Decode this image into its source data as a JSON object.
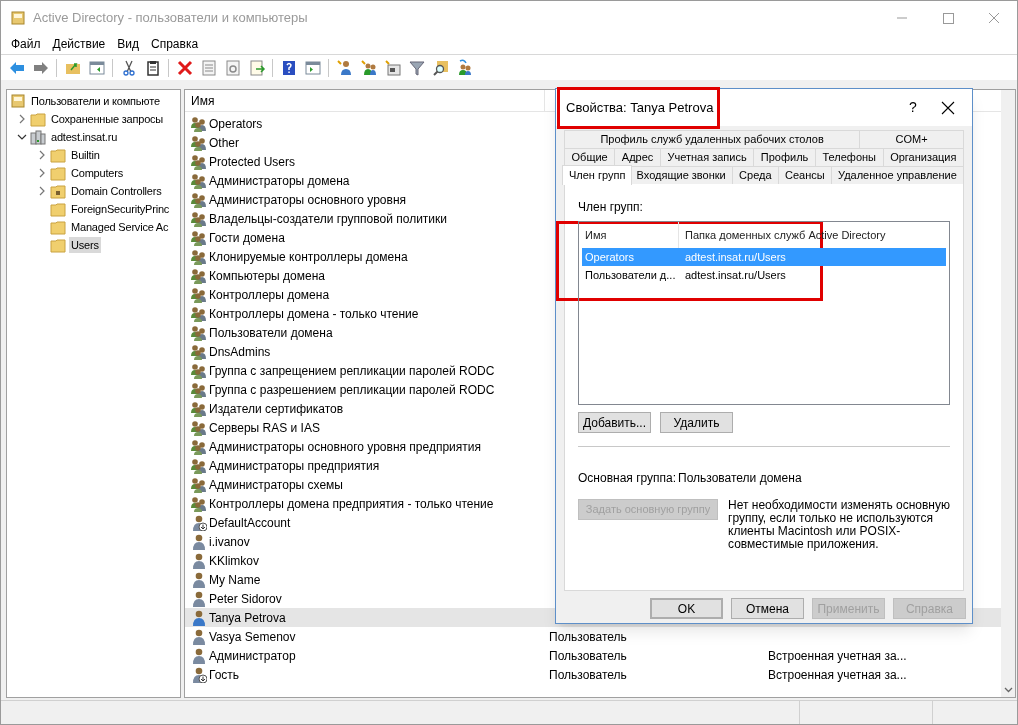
{
  "window": {
    "title": "Active Directory - пользователи и компьютеры"
  },
  "menu": [
    "Файл",
    "Действие",
    "Вид",
    "Справка"
  ],
  "tree": {
    "label": "Пользователи и компьюте",
    "kind": "root",
    "children": [
      {
        "label": "Сохраненные запросы",
        "kind": "folder",
        "expanded": false,
        "selected": false
      },
      {
        "label": "adtest.insat.ru",
        "kind": "domain",
        "expanded": true,
        "selected": false,
        "children": [
          {
            "label": "Builtin",
            "kind": "folder",
            "expanded": false,
            "selected": false
          },
          {
            "label": "Computers",
            "kind": "folder",
            "expanded": false,
            "selected": false
          },
          {
            "label": "Domain Controllers",
            "kind": "ou",
            "expanded": false,
            "selected": false
          },
          {
            "label": "ForeignSecurityPrinc",
            "kind": "folder",
            "selected": false
          },
          {
            "label": "Managed Service Ac",
            "kind": "folder",
            "selected": false
          },
          {
            "label": "Users",
            "kind": "folder",
            "selected": true
          }
        ]
      }
    ]
  },
  "list": {
    "columns": [
      "Имя"
    ],
    "rows": [
      {
        "name": "Operators",
        "kind": "group",
        "selected": false
      },
      {
        "name": "Other",
        "kind": "group",
        "selected": false
      },
      {
        "name": "Protected Users",
        "kind": "group",
        "selected": false
      },
      {
        "name": "Администраторы домена",
        "kind": "group",
        "selected": false
      },
      {
        "name": "Администраторы основного уровня",
        "kind": "group",
        "selected": false
      },
      {
        "name": "Владельцы-создатели групповой политики",
        "kind": "group",
        "selected": false
      },
      {
        "name": "Гости домена",
        "kind": "group",
        "selected": false
      },
      {
        "name": "Клонируемые контроллеры домена",
        "kind": "group",
        "selected": false
      },
      {
        "name": "Компьютеры домена",
        "kind": "group",
        "selected": false
      },
      {
        "name": "Контроллеры домена",
        "kind": "group",
        "selected": false
      },
      {
        "name": "Контроллеры домена - только чтение",
        "kind": "group",
        "selected": false
      },
      {
        "name": "Пользователи домена",
        "kind": "group",
        "selected": false
      },
      {
        "name": "DnsAdmins",
        "kind": "group",
        "selected": false
      },
      {
        "name": "Группа с запрещением репликации паролей RODC",
        "kind": "group",
        "selected": false
      },
      {
        "name": "Группа с разрешением репликации паролей RODC",
        "kind": "group",
        "selected": false
      },
      {
        "name": "Издатели сертификатов",
        "kind": "group",
        "selected": false
      },
      {
        "name": "Серверы RAS и IAS",
        "kind": "group",
        "selected": false
      },
      {
        "name": "Администраторы основного уровня предприятия",
        "kind": "group",
        "selected": false
      },
      {
        "name": "Администраторы предприятия",
        "kind": "group",
        "selected": false
      },
      {
        "name": "Администраторы схемы",
        "kind": "group",
        "selected": false
      },
      {
        "name": "Контроллеры домена предприятия - только чтение",
        "kind": "group",
        "selected": false
      },
      {
        "name": "DefaultAccount",
        "kind": "disabled-user",
        "selected": false
      },
      {
        "name": "i.ivanov",
        "kind": "user",
        "selected": false
      },
      {
        "name": "KKlimkov",
        "kind": "user",
        "selected": false
      },
      {
        "name": "My Name",
        "kind": "user",
        "selected": false
      },
      {
        "name": "Peter Sidorov",
        "kind": "user",
        "selected": false
      },
      {
        "name": "Tanya Petrova",
        "kind": "user",
        "selected": true
      },
      {
        "name": "Vasya Semenov",
        "kind": "user",
        "selected": false,
        "column_2": "Пользователь"
      },
      {
        "name": "Администратор",
        "kind": "user",
        "selected": false,
        "column_2": "Пользователь",
        "column_3": "Встроенная учетная за..."
      },
      {
        "name": "Гость",
        "kind": "disabled-user",
        "selected": false,
        "column_2": "Пользователь",
        "column_3": "Встроенная учетная за..."
      }
    ]
  },
  "dialog": {
    "title": "Свойства: Tanya Petrova",
    "title_highlighted": true,
    "help": "?",
    "tab_rows": [
      [
        {
          "label": "Профиль служб удаленных рабочих столов",
          "selected": false
        },
        {
          "label": "COM+",
          "selected": false
        }
      ],
      [
        {
          "label": "Общие",
          "selected": false
        },
        {
          "label": "Адрес",
          "selected": false
        },
        {
          "label": "Учетная запись",
          "selected": false
        },
        {
          "label": "Профиль",
          "selected": false
        },
        {
          "label": "Телефоны",
          "selected": false
        },
        {
          "label": "Организация",
          "selected": false
        }
      ],
      [
        {
          "label": "Член групп",
          "selected": true
        },
        {
          "label": "Входящие звонки",
          "selected": false
        },
        {
          "label": "Среда",
          "selected": false
        },
        {
          "label": "Сеансы",
          "selected": false
        },
        {
          "label": "Удаленное управление",
          "selected": false
        }
      ]
    ],
    "members_label": "Член групп:",
    "members": {
      "highlighted": true,
      "columns": [
        "Имя",
        "Папка доменных служб Active Directory"
      ],
      "rows": [
        {
          "name": "Operators",
          "folder": "adtest.insat.ru/Users",
          "selected": true
        },
        {
          "name": "Пользователи д...",
          "folder": "adtest.insat.ru/Users",
          "selected": false
        }
      ]
    },
    "member_buttons": [
      "Добавить...",
      "Удалить"
    ],
    "primary_group_label": "Основная группа:",
    "primary_group": "Пользователи домена",
    "set_primary": {
      "label": "Задать основную группу",
      "disabled": true
    },
    "note": "Нет необходимости изменять основную группу, если только не используются клиенты Macintosh или POSIX-совместимые приложения.",
    "buttons": [
      {
        "label": "OK",
        "default": true,
        "disabled": false
      },
      {
        "label": "Отмена",
        "default": false,
        "disabled": false
      },
      {
        "label": "Применить",
        "default": false,
        "disabled": true
      },
      {
        "label": "Справка",
        "default": false,
        "disabled": true
      }
    ]
  }
}
